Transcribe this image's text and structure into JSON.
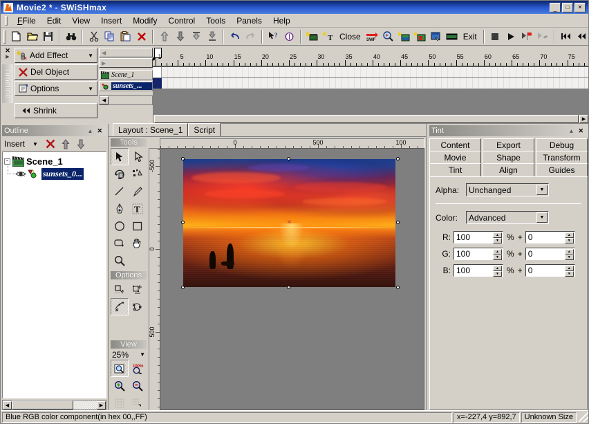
{
  "window": {
    "title": "Movie2 * - SWiSHmax",
    "icon": "swishmax-app-icon",
    "minimize_label": "_",
    "maximize_label": "□",
    "close_label": "✕"
  },
  "menubar": {
    "items": [
      {
        "label": "File",
        "mnemonic": "F"
      },
      {
        "label": "Edit",
        "mnemonic": "E"
      },
      {
        "label": "View",
        "mnemonic": "V"
      },
      {
        "label": "Insert",
        "mnemonic": "I"
      },
      {
        "label": "Modify",
        "mnemonic": "M"
      },
      {
        "label": "Control",
        "mnemonic": "C"
      },
      {
        "label": "Tools",
        "mnemonic": "T"
      },
      {
        "label": "Panels",
        "mnemonic": "P"
      },
      {
        "label": "Help",
        "mnemonic": "H"
      }
    ]
  },
  "toolbar": {
    "groups": [
      [
        "new-file-icon",
        "open-folder-icon",
        "save-disk-icon"
      ],
      [
        "find-binoculars-icon"
      ],
      [
        "cut-scissors-icon",
        "copy-icon",
        "paste-icon",
        "delete-x-icon"
      ],
      [
        "bring-to-front-icon",
        "send-to-back-icon",
        "bring-forward-icon",
        "send-backward-icon"
      ],
      [
        "undo-icon",
        "redo-icon"
      ],
      [
        "help-pointer-icon",
        "reference-book-icon"
      ]
    ],
    "group2": [
      [
        "insert-scene-icon",
        "insert-text-icon"
      ]
    ],
    "close_label": "Close",
    "exportIcons": [
      "export-swf-icon",
      "preview-magnifier-icon",
      "export-html-icon",
      "export-image-icon",
      "test-in-browser-icon",
      "export-avi-icon"
    ],
    "exit_label": "Exit",
    "playback": [
      "stop-icon",
      "play-icon",
      "play-scene-icon",
      "play-effect-icon"
    ],
    "transport": [
      "rewind-to-start-icon",
      "step-back-icon",
      "step-forward-to-end-icon"
    ]
  },
  "timeline": {
    "dock_label": "Timeline",
    "collapse_icon": "collapse-arrow-icon",
    "close_icon": "close-x-icon",
    "buttons": [
      {
        "label": "Add Effect",
        "icon": "add-effect-icon",
        "has_dropdown": true
      },
      {
        "label": "Del Object",
        "icon": "delete-red-x-icon",
        "has_dropdown": false
      },
      {
        "label": "Options",
        "icon": "options-icon",
        "has_dropdown": true
      },
      {
        "label": "Shrink",
        "icon": "shrink-icon",
        "has_dropdown": false
      }
    ],
    "nav_up_icon": "scroll-up-icon",
    "nav_down_icon": "scroll-down-icon",
    "rows": [
      {
        "label": "Scene_1",
        "icon": "clapperboard-icon",
        "selected": false
      },
      {
        "label": "sunsets_...",
        "icon": "sprite-object-icon",
        "selected": true
      }
    ],
    "ruler": {
      "start_marker": "▶",
      "labels": [
        1,
        5,
        10,
        15,
        20,
        25,
        30,
        35,
        40,
        45,
        50,
        55,
        60,
        65,
        70,
        75
      ],
      "playhead_frame": 1
    }
  },
  "outline": {
    "title": "Outline",
    "collapse_icon": "collapse-arrow-icon",
    "close_icon": "close-x-icon",
    "toolbar": {
      "insert_label": "Insert",
      "insert_dropdown_icon": "chevron-down-icon",
      "delete_icon": "delete-red-x-icon",
      "move-up_icon": "move-up-arrow-icon",
      "move-down_icon": "move-down-arrow-icon"
    },
    "tree": {
      "root": {
        "label": "Scene_1",
        "icon": "clapperboard-icon",
        "expanded": true,
        "toggle": "-"
      },
      "child": {
        "label": "sunsets_0...",
        "icons": [
          "eye-visibility-icon",
          "shape-object-icon"
        ],
        "selected": true
      }
    }
  },
  "layout": {
    "tabs": [
      {
        "label": "Layout : Scene_1",
        "active": true
      },
      {
        "label": "Script",
        "active": false
      }
    ],
    "ruler_h_labels": [
      "0",
      "500",
      "100"
    ],
    "ruler_v_labels": [
      "-500",
      "0",
      "500"
    ],
    "canvas": {
      "image_name": "sunsets_0",
      "selected": true,
      "handles": 8,
      "center_marker": "selection-center-icon"
    }
  },
  "tools": {
    "header": "Tools",
    "items": [
      {
        "name": "select-arrow-tool",
        "pressed": true
      },
      {
        "name": "subselect-arrow-tool",
        "pressed": false
      },
      {
        "name": "reshape-tool",
        "pressed": false
      },
      {
        "name": "motion-path-tool",
        "pressed": false
      },
      {
        "name": "line-tool",
        "pressed": false
      },
      {
        "name": "pencil-tool",
        "pressed": false
      },
      {
        "name": "bezier-pen-tool",
        "pressed": false
      },
      {
        "name": "text-tool",
        "pressed": false
      },
      {
        "name": "ellipse-tool",
        "pressed": false
      },
      {
        "name": "rectangle-tool",
        "pressed": false
      },
      {
        "name": "autoshape-tool",
        "pressed": false
      },
      {
        "name": "pan-hand-tool",
        "pressed": false
      },
      {
        "name": "zoom-magnifier-tool",
        "pressed": false
      }
    ],
    "options_header": "Options",
    "options": [
      {
        "name": "snap-to-grid-option",
        "pressed": false
      },
      {
        "name": "transform-option",
        "pressed": false
      },
      {
        "name": "edit-points-option",
        "pressed": true
      },
      {
        "name": "close-path-option",
        "pressed": false
      }
    ],
    "view_header": "View",
    "zoom_value": "25%",
    "zoom_dropdown_icon": "chevron-down-icon",
    "view_buttons": [
      {
        "name": "zoom-to-fit-icon",
        "pressed": true
      },
      {
        "name": "zoom-100-percent-icon",
        "label": "100%",
        "pressed": false
      },
      {
        "name": "zoom-in-icon",
        "pressed": false
      },
      {
        "name": "zoom-out-icon",
        "pressed": false
      },
      {
        "name": "show-grid-icon",
        "pressed": false
      },
      {
        "name": "snap-to-grid-icon",
        "pressed": false
      }
    ]
  },
  "tint_panel": {
    "title": "Tint",
    "collapse_icon": "collapse-arrow-icon",
    "close_icon": "close-x-icon",
    "tab_rows": [
      [
        {
          "label": "Content",
          "active": false
        },
        {
          "label": "Export",
          "active": false
        },
        {
          "label": "Debug",
          "active": false
        }
      ],
      [
        {
          "label": "Movie",
          "active": false
        },
        {
          "label": "Shape",
          "active": false
        },
        {
          "label": "Transform",
          "active": false
        }
      ],
      [
        {
          "label": "Tint",
          "active": true
        },
        {
          "label": "Align",
          "active": false
        },
        {
          "label": "Guides",
          "active": false
        }
      ]
    ],
    "alpha": {
      "label": "Alpha:",
      "value": "Unchanged",
      "dropdown_icon": "chevron-down-icon"
    },
    "color": {
      "label": "Color:",
      "value": "Advanced",
      "dropdown_icon": "chevron-down-icon"
    },
    "channels": [
      {
        "label": "R:",
        "percent": "100",
        "offset": "0"
      },
      {
        "label": "G:",
        "percent": "100",
        "offset": "0"
      },
      {
        "label": "B:",
        "percent": "100",
        "offset": "0"
      }
    ],
    "percent_symbol": "%",
    "plus_symbol": "+"
  },
  "statusbar": {
    "hint": "Blue RGB color component(in hex 00,,FF)",
    "coords": "x=-227,4 y=892,7",
    "size": "Unknown Size"
  }
}
